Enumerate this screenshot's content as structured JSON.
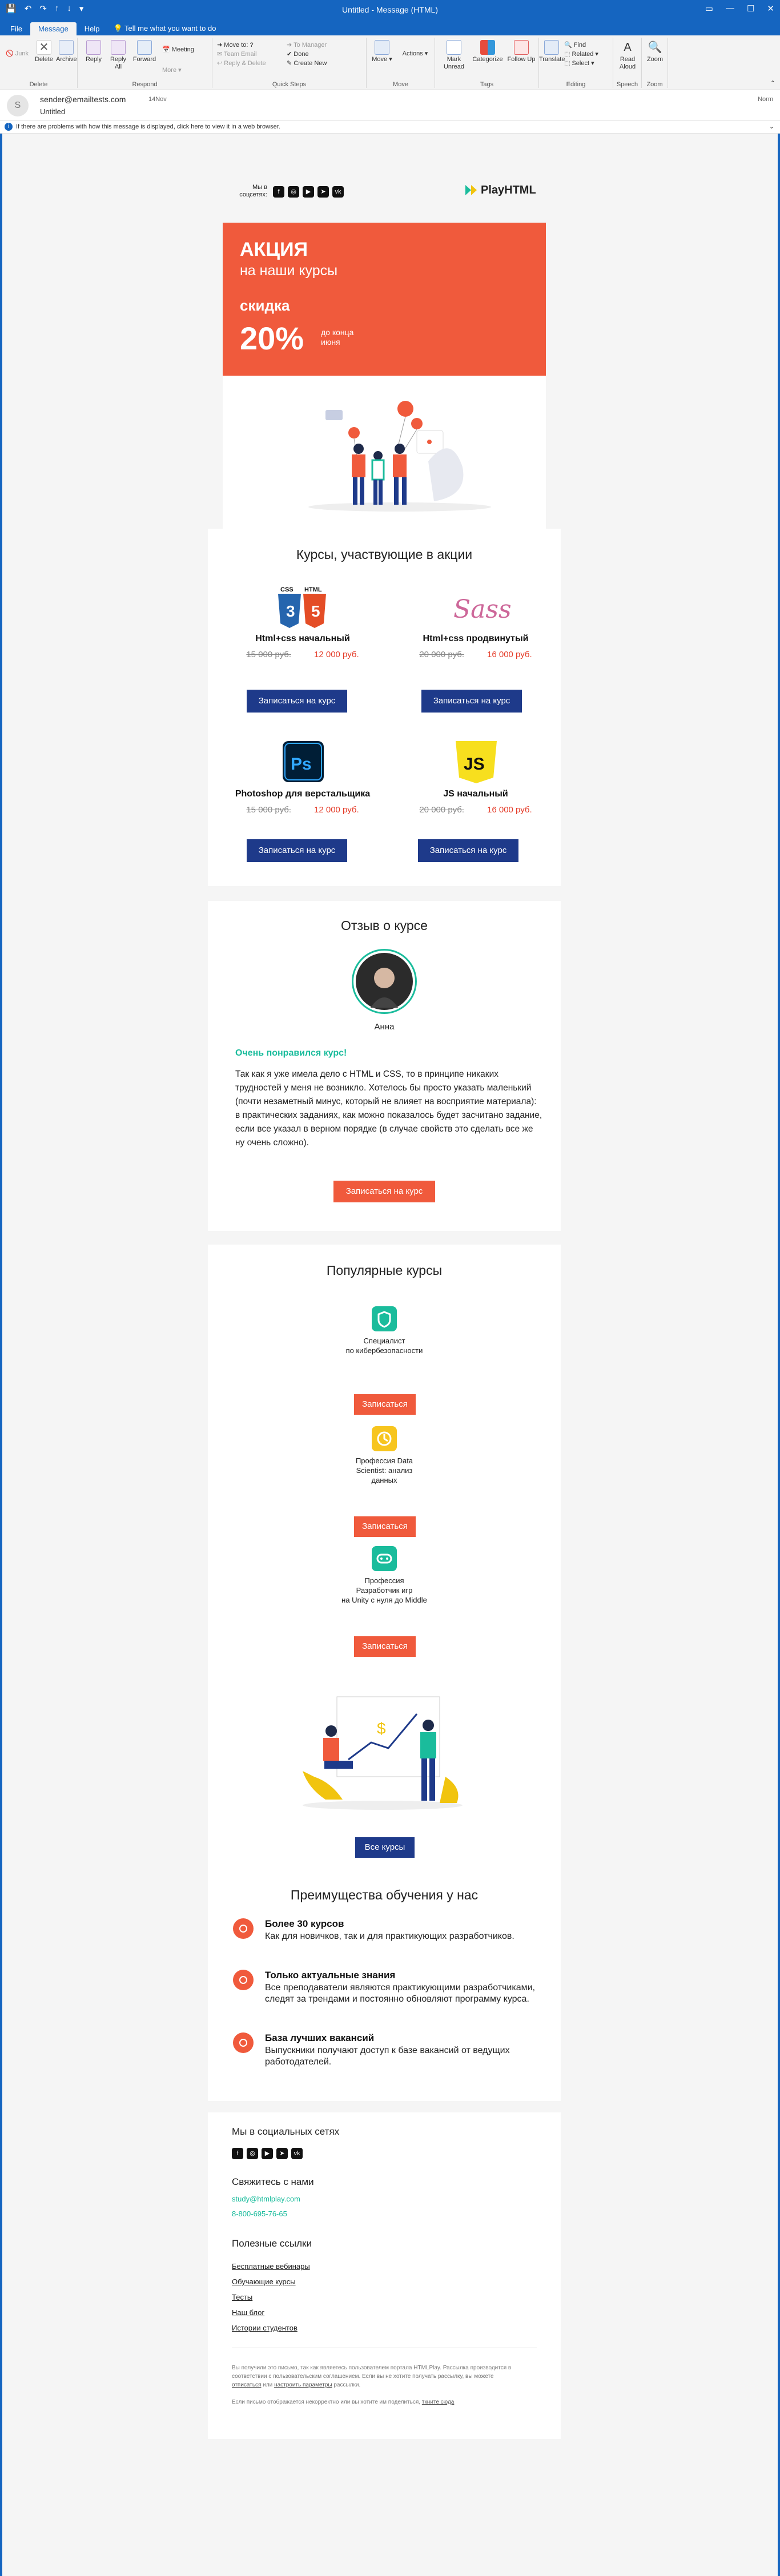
{
  "titlebar": {
    "title": "Untitled - Message (HTML)"
  },
  "tabs": [
    {
      "label": "File"
    },
    {
      "label": "Message"
    },
    {
      "label": "Help"
    }
  ],
  "tell_me": "Tell me what you want to do",
  "ribbon": {
    "delete_group": {
      "label": "Delete",
      "ignore": "Junk",
      "delete": "Delete",
      "archive": "Archive"
    },
    "respond_group": {
      "label": "Respond",
      "reply": "Reply",
      "reply_all": "Reply All",
      "forward": "Forward",
      "meeting": "Meeting",
      "more": "More"
    },
    "quicksteps_group": {
      "label": "Quick Steps",
      "items": [
        "Move to: ?",
        "Team Email",
        "Reply & Delete",
        "To Manager",
        "Done",
        "Create New"
      ]
    },
    "move_group": {
      "label": "Move",
      "move": "Move",
      "actions": "Actions"
    },
    "tags_group": {
      "label": "Tags",
      "mark_unread": "Mark Unread",
      "categorize": "Categorize",
      "follow_up": "Follow Up"
    },
    "editing_group": {
      "label": "Editing",
      "find": "Find",
      "related": "Related",
      "select": "Select",
      "translate": "Translate"
    },
    "speech_group": {
      "label": "Speech",
      "read_aloud": "Read Aloud"
    },
    "zoom_group": {
      "label": "Zoom",
      "zoom": "Zoom"
    }
  },
  "header": {
    "avatar_letter": "S",
    "sender": "sender@emailtests.com",
    "date": "14Nov",
    "subject": "Untitled",
    "recipient": "Norm"
  },
  "infobar": "If there are problems with how this message is displayed, click here to view it in a web browser.",
  "email": {
    "top": {
      "social_label": "Мы в соцсетях:",
      "logo": "PlayHTML"
    },
    "hero": {
      "title_line1": "АКЦИЯ",
      "title_line2": "на наши курсы",
      "discount_label": "скидка",
      "discount_value": "20%",
      "until": "до конца июня"
    },
    "courses": {
      "heading": "Курсы, участвующие в акции",
      "button": "Записаться на курс",
      "items": [
        {
          "name": "Html+css начальный",
          "old": "15 000 руб.",
          "new": "12 000 руб."
        },
        {
          "name": "Html+css продвинутый",
          "old": "20 000 руб.",
          "new": "16 000 руб."
        },
        {
          "name": "Photoshop для верстальщика",
          "old": "15 000 руб.",
          "new": "12 000 руб."
        },
        {
          "name": "JS начальный",
          "old": "20 000 руб.",
          "new": "16 000 руб."
        }
      ]
    },
    "review": {
      "heading": "Отзыв о курсе",
      "name": "Анна",
      "headline": "Очень понравился курс!",
      "text": "Так как я уже имела дело с HTML и CSS, то в принципе никаких трудностей у меня не возникло. Хотелось бы просто указать маленький (почти незаметный минус, который не влияет на восприятие материала): в практических заданиях, как можно показалось будет засчитано задание, если все указал в верном порядке (в случае свойств это сделать все же ну очень сложно).",
      "button": "Записаться на курс"
    },
    "popular": {
      "heading": "Популярные курсы",
      "button": "Записаться",
      "items": [
        {
          "line1": "Специалист",
          "line2": "по кибербезопасности",
          "line3": ""
        },
        {
          "line1": "Профессия Data",
          "line2": "Scientist: анализ",
          "line3": "данных"
        },
        {
          "line1": "Профессия",
          "line2": "Разработчик игр",
          "line3": "на Unity с нуля до Middle"
        }
      ],
      "all_button": "Все курсы"
    },
    "advantages": {
      "heading": "Преимущества обучения у нас",
      "items": [
        {
          "title": "Более 30 курсов",
          "desc": "Как для новичков, так и для практикующих разработчиков."
        },
        {
          "title": "Только актуальные знания",
          "desc": "Все преподаватели являются практикующими разработчиками, следят за трендами и постоянно обновляют программу курса."
        },
        {
          "title": "База лучших вакансий",
          "desc": "Выпускники получают доступ к базе вакансий от ведущих работодателей."
        }
      ]
    },
    "footer": {
      "social_heading": "Мы в социальных сетях",
      "contact_heading": "Свяжитесь с нами",
      "email": "study@htmlplay.com",
      "phone": "8-800-695-76-65",
      "links_heading": "Полезные ссылки",
      "links": [
        "Бесплатные вебинары",
        "Обучающие курсы",
        "Тесты",
        "Наш блог",
        "Истории студентов"
      ],
      "legal_1a": "Вы получили это письмо, так как являетесь пользователем портала HTMLPlay. Рассылка производится в соответствии с пользовательским соглашением. Если вы не хотите получать рассылку, вы можете ",
      "legal_1_link1": "отписаться",
      "legal_1b": " или ",
      "legal_1_link2": "настроить параметры",
      "legal_1c": " рассылки.",
      "legal_2a": "Если письмо отображается некорректно или вы хотите им поделиться, ",
      "legal_2_link": "ткните сюда"
    }
  },
  "colors": {
    "outlook_blue": "#1565c0",
    "accent_red": "#f05a3c",
    "button_blue": "#1e3a8a",
    "teal": "#1abc9c"
  }
}
